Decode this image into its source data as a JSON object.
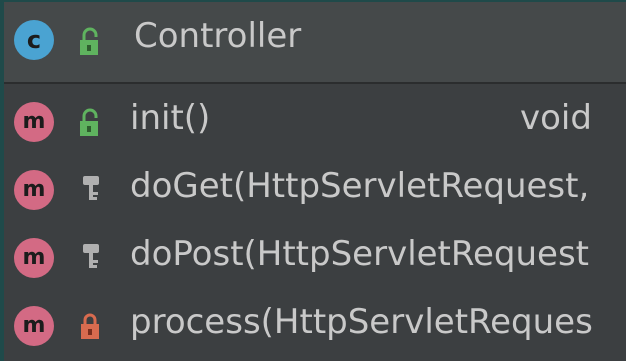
{
  "class_node": {
    "badge": "c",
    "title": "Controller",
    "icon": "public-lock-icon"
  },
  "members": [
    {
      "badge": "m",
      "visibility": "public",
      "icon": "public-lock-icon",
      "name": "init()",
      "type": "void"
    },
    {
      "badge": "m",
      "visibility": "protected",
      "icon": "protected-key-icon",
      "name": "doGet(HttpServletRequest,",
      "type": ""
    },
    {
      "badge": "m",
      "visibility": "protected",
      "icon": "protected-key-icon",
      "name": "doPost(HttpServletRequest",
      "type": ""
    },
    {
      "badge": "m",
      "visibility": "private",
      "icon": "private-lock-icon",
      "name": "process(HttpServletReques",
      "type": ""
    }
  ],
  "colors": {
    "class_badge": "#4aa3d2",
    "method_badge": "#d36a84",
    "public_icon": "#5fb35f",
    "private_icon": "#d86b4f",
    "protected_icon": "#b0b0b0"
  }
}
